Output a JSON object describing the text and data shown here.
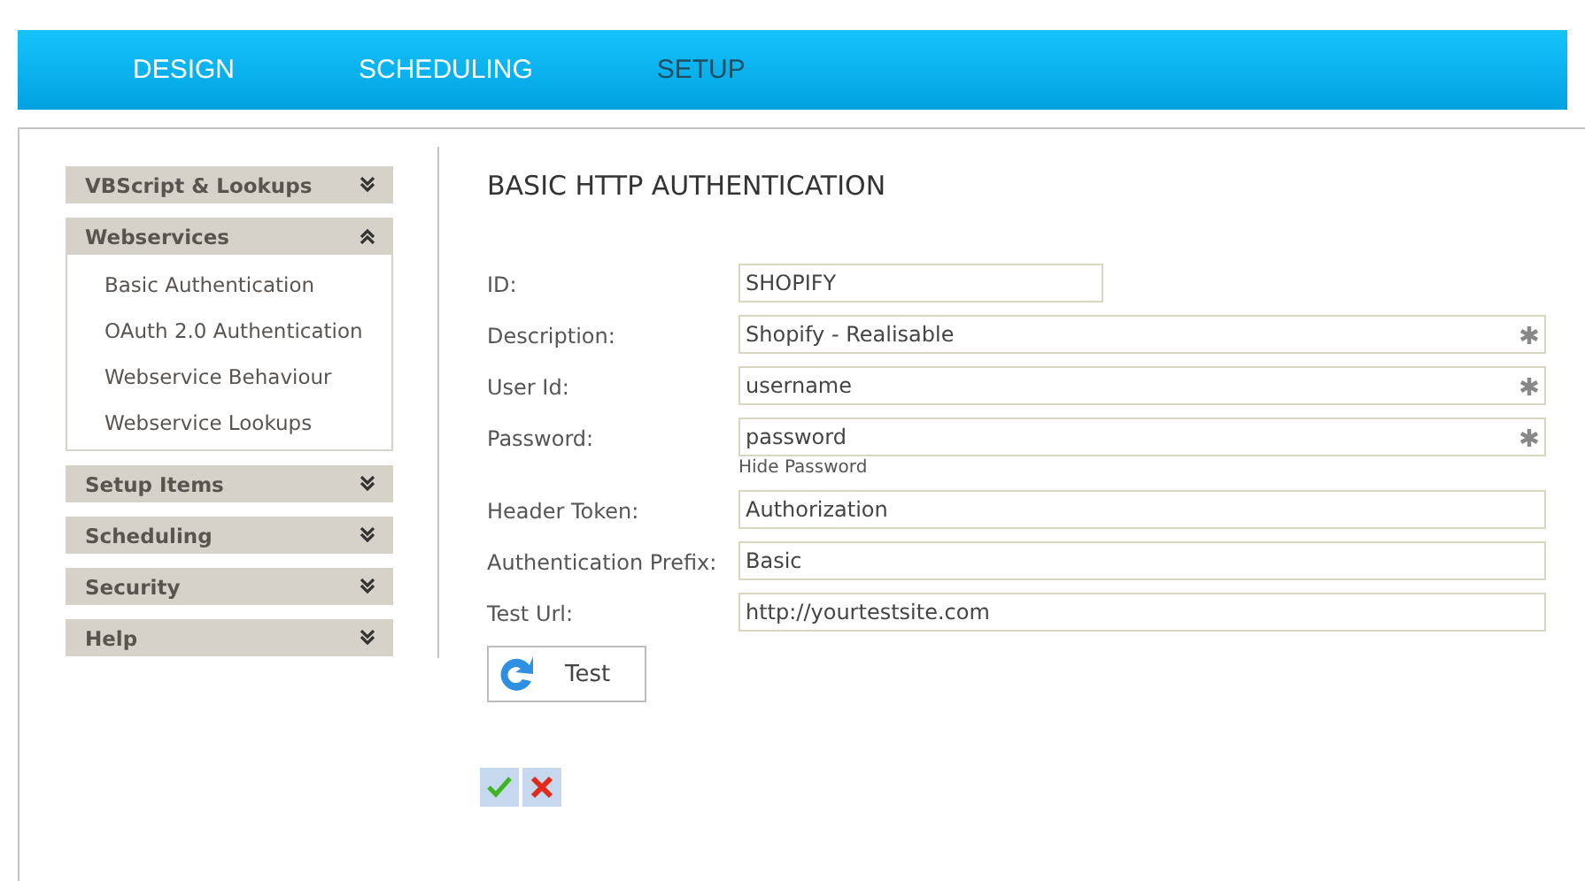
{
  "nav": {
    "tabs": [
      {
        "label": "DESIGN",
        "selected": false
      },
      {
        "label": "SCHEDULING",
        "selected": false
      },
      {
        "label": "SETUP",
        "selected": true
      }
    ]
  },
  "sidebar": {
    "sections": [
      {
        "title": "VBScript & Lookups",
        "expanded": false
      },
      {
        "title": "Webservices",
        "expanded": true,
        "items": [
          "Basic Authentication",
          "OAuth 2.0 Authentication",
          "Webservice Behaviour",
          "Webservice Lookups"
        ]
      },
      {
        "title": "Setup Items",
        "expanded": false
      },
      {
        "title": "Scheduling",
        "expanded": false
      },
      {
        "title": "Security",
        "expanded": false
      },
      {
        "title": "Help",
        "expanded": false
      }
    ]
  },
  "form": {
    "title": "BASIC HTTP AUTHENTICATION",
    "fields": [
      {
        "label": "ID:",
        "value": "SHOPIFY",
        "kind": "short",
        "required": false
      },
      {
        "label": "Description:",
        "value": "Shopify - Realisable",
        "kind": "wide",
        "required": true
      },
      {
        "label": "User Id:",
        "value": "username",
        "kind": "wide",
        "required": true
      },
      {
        "label": "Password:",
        "value": "password",
        "kind": "wide",
        "required": true,
        "link": "Hide Password"
      },
      {
        "label": "Header Token:",
        "value": "Authorization",
        "kind": "wide",
        "required": false
      },
      {
        "label": "Authentication Prefix:",
        "value": "Basic",
        "kind": "wide",
        "required": false
      },
      {
        "label": "Test Url:",
        "value": "http://yourtestsite.com",
        "kind": "wide",
        "required": false
      }
    ],
    "test_button": "Test"
  }
}
